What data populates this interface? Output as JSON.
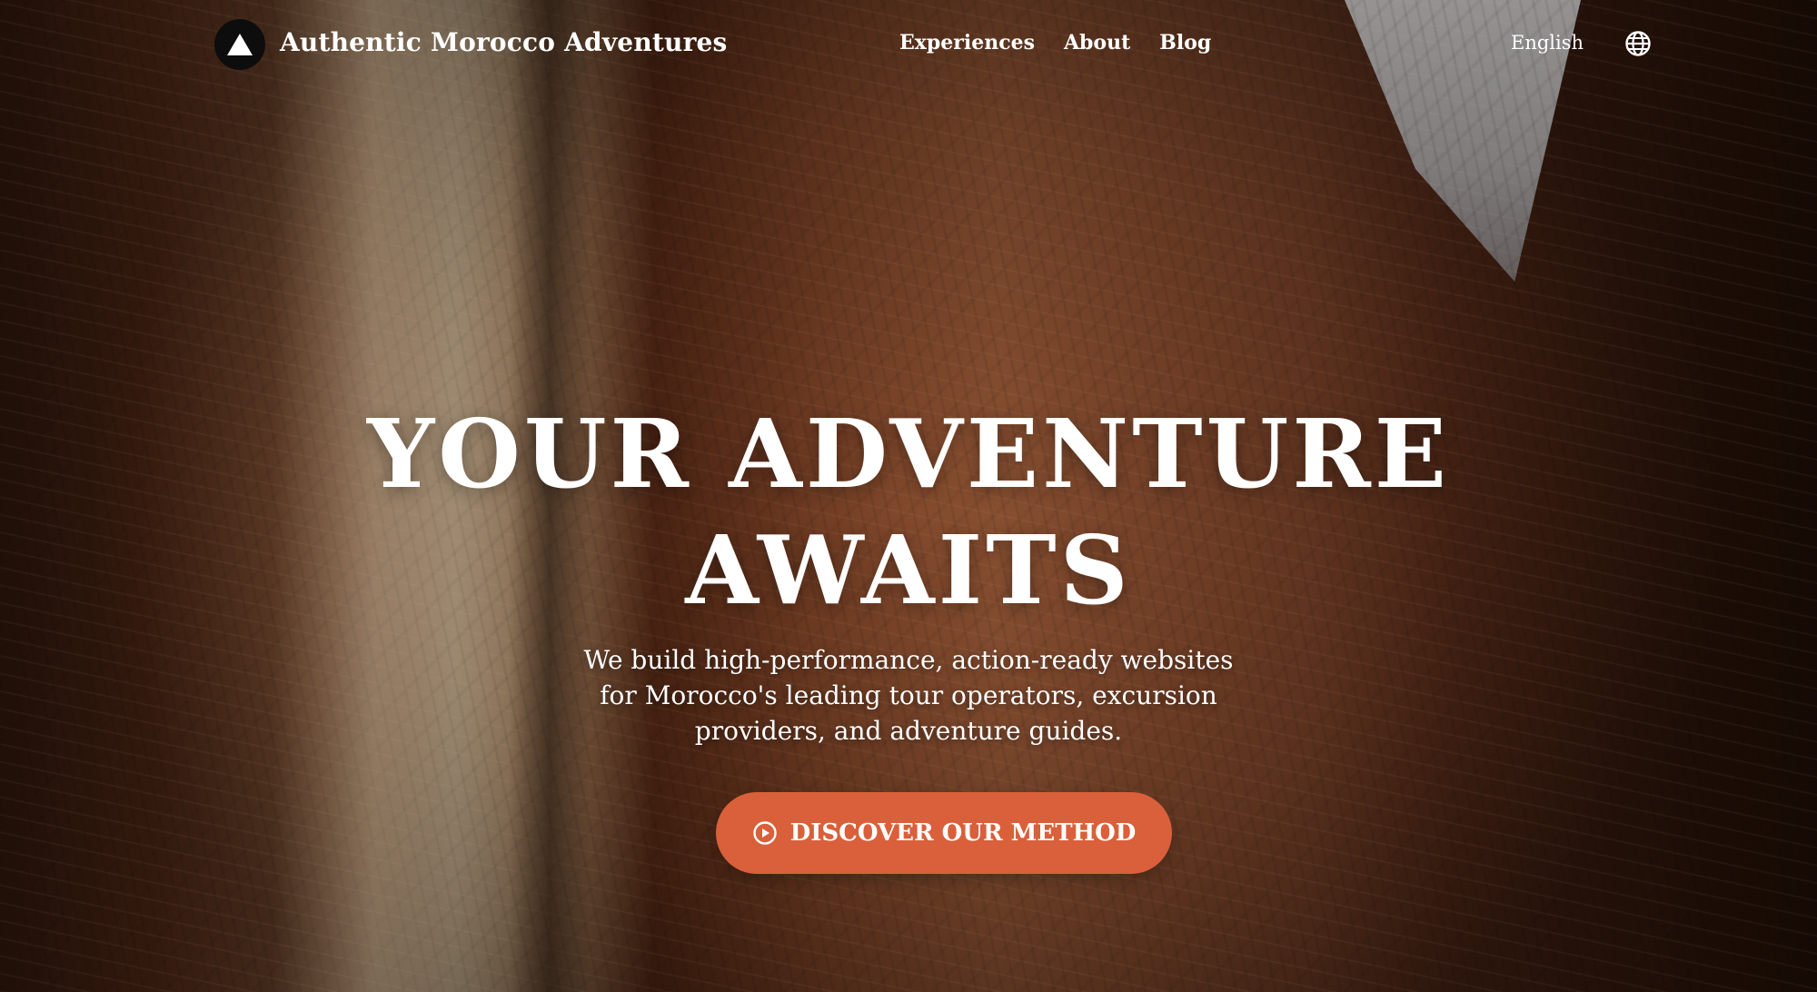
{
  "header": {
    "brand_name": "Authentic Morocco Adventures",
    "logo_icon": "mountain-triangle-icon",
    "nav": [
      {
        "label": "Experiences"
      },
      {
        "label": "About"
      },
      {
        "label": "Blog"
      }
    ],
    "language": "English",
    "language_icon": "globe-icon"
  },
  "hero": {
    "headline_line1": "YOUR ADVENTURE",
    "headline_line2": "AWAITS",
    "subtext": "We build high-performance, action-ready websites for Morocco's leading tour operators, excursion providers, and adventure guides.",
    "cta_label": "DISCOVER OUR METHOD",
    "cta_icon": "play-circle-icon"
  },
  "colors": {
    "accent": "#d9603a",
    "text": "#ffffff",
    "logo_bg": "#0d0d0d"
  }
}
